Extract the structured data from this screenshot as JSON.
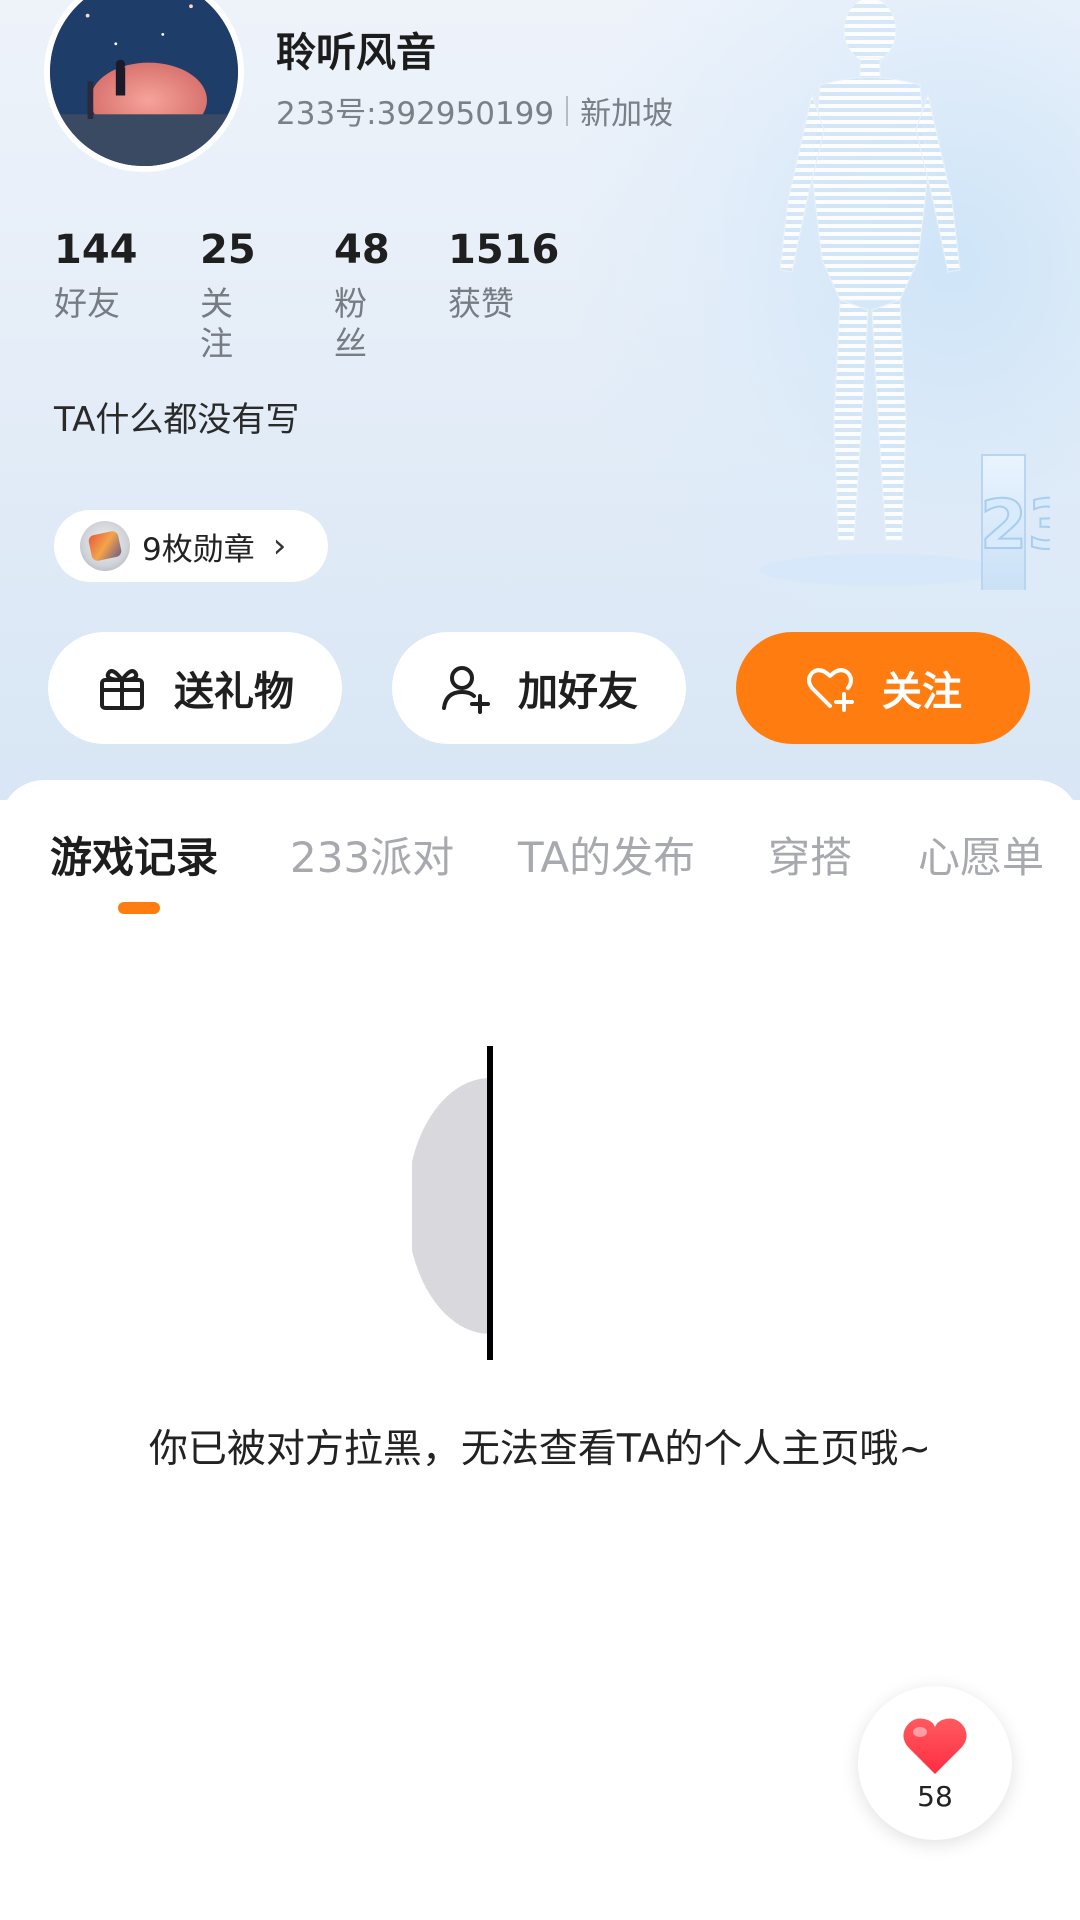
{
  "profile": {
    "nickname": "聆听风音",
    "id_text": "233号:392950199",
    "location": "新加坡",
    "bio": "TA什么都没有写"
  },
  "stats": [
    {
      "value": "144",
      "label": "好友"
    },
    {
      "value": "25",
      "label": "关注"
    },
    {
      "value": "48",
      "label": "粉丝"
    },
    {
      "value": "1516",
      "label": "获赞"
    }
  ],
  "medals": {
    "label": "9枚勋章",
    "icon": "medal-icon"
  },
  "actions": {
    "gift": {
      "label": "送礼物",
      "icon": "gift-icon"
    },
    "add_friend": {
      "label": "加好友",
      "icon": "add-user-icon"
    },
    "follow": {
      "label": "关注",
      "icon": "heart-plus-icon"
    }
  },
  "tabs": [
    "游戏记录",
    "233派对",
    "TA的发布",
    "穿搭",
    "心愿单"
  ],
  "active_tab": "游戏记录",
  "empty_state": {
    "message": "你已被对方拉黑，无法查看TA的个人主页哦~"
  },
  "like_button": {
    "count": "58",
    "icon": "heart-icon"
  },
  "colors": {
    "accent": "#ff7d10",
    "header_bg": "#e6eef8",
    "heart": "#ff3b4b"
  }
}
